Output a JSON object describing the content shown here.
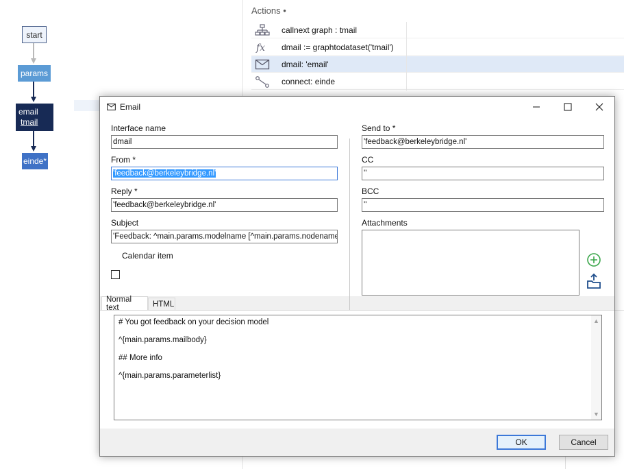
{
  "graph": {
    "nodes": {
      "start": "start",
      "params": "params",
      "email_type": "email",
      "email_name": "tmail",
      "einde": "einde*"
    }
  },
  "actions": {
    "title": "Actions •",
    "items": [
      {
        "label": "callnext graph : tmail",
        "icon": "hierarchy-icon"
      },
      {
        "label": "dmail := graphtodataset('tmail')",
        "icon": "function-icon"
      },
      {
        "label": "dmail: 'email'",
        "icon": "envelope-icon",
        "selected": true
      },
      {
        "label": "connect: einde",
        "icon": "connector-icon"
      }
    ]
  },
  "dialog": {
    "title": "Email",
    "left": {
      "interface_name_label": "Interface name",
      "interface_name_value": "dmail",
      "from_label": "From *",
      "from_value": "'feedback@berkeleybridge.nl'",
      "reply_label": "Reply *",
      "reply_value": "'feedback@berkeleybridge.nl'",
      "subject_label": "Subject",
      "subject_value": "'Feedback: ^main.params.modelname [^main.params.nodename]'",
      "calendar_label": "Calendar item"
    },
    "right": {
      "send_to_label": "Send to *",
      "send_to_value": "'feedback@berkeleybridge.nl'",
      "cc_label": "CC",
      "cc_value": "''",
      "bcc_label": "BCC",
      "bcc_value": "''",
      "attachments_label": "Attachments"
    },
    "tabs": [
      "Normal text",
      "HTML"
    ],
    "body_lines": [
      "# You got feedback on your decision model",
      "^{main.params.mailbody}",
      "## More info",
      "^{main.params.parameterlist}"
    ],
    "ok_label": "OK",
    "cancel_label": "Cancel"
  },
  "colors": {
    "accent": "#3c78d8",
    "selection": "#3399ff",
    "add_green": "#3aa64a",
    "open_blue": "#1f4e8c"
  }
}
